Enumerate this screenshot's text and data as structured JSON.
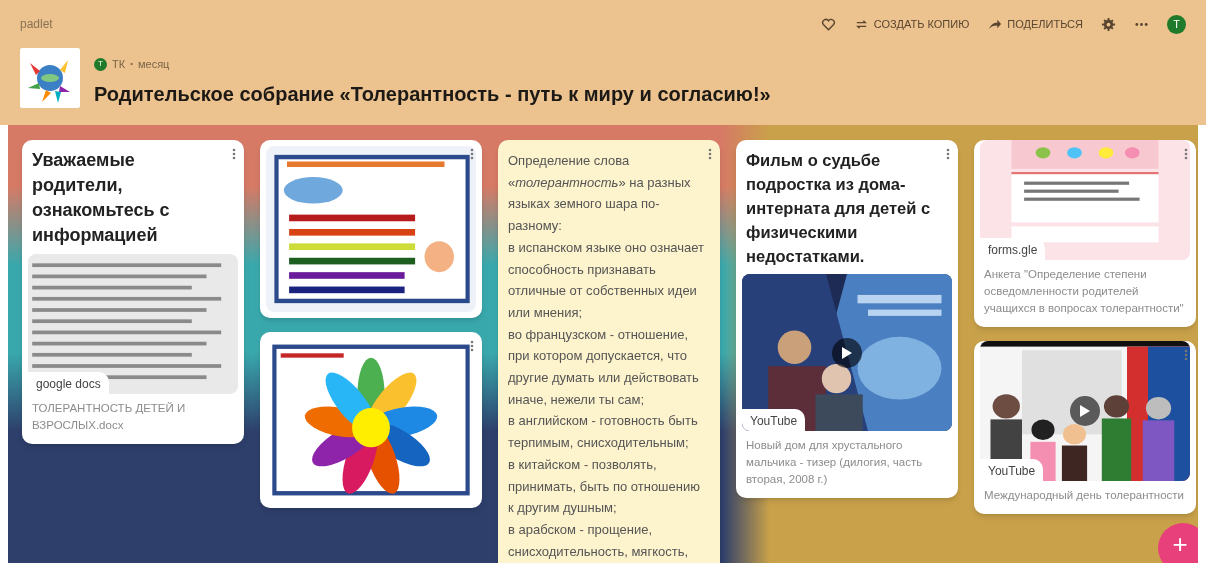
{
  "app": {
    "logo_text": "padlet"
  },
  "toolbar": {
    "actions": [
      {
        "kind": "like"
      },
      {
        "kind": "remix",
        "label": "СОЗДАТЬ КОПИЮ"
      },
      {
        "kind": "share",
        "label": "ПОДЕЛИТЬСЯ"
      },
      {
        "kind": "settings"
      },
      {
        "kind": "more"
      }
    ],
    "avatar": "T"
  },
  "board": {
    "author": {
      "avatar": "T",
      "name": "ТК",
      "separator": "•",
      "time": "месяц"
    },
    "title": "Родительское собрание «Толерантность - путь к миру и согласию!»"
  },
  "columns": [
    {
      "posts": [
        {
          "color": "#ffffff",
          "subject": "Уважаемые родители, ознакомьтесь с информацией",
          "attachment": {
            "kind": "document",
            "source": "google docs",
            "caption": "ТОЛЕРАНТНОСТЬ ДЕТЕЙ И ВЗРОСЛЫХ.docx"
          }
        }
      ]
    },
    {
      "posts": [
        {
          "color": "#ffffff"
        },
        {
          "color": "#ffffff"
        }
      ]
    },
    {
      "posts": [
        {
          "color": "#fdf3cd",
          "body": [
            "Определение слова «*толерантность*» на разных языках земного шара по-разному:",
            "в испанском языке оно означает способность признавать отличные от собственных идеи или мнения;",
            "во французском - отношение, при котором допускается, что другие думать или действовать иначе, нежели ты сам;",
            "в английском - готовность быть терпимым, снисходительным;",
            "в китайском - позволять, принимать, быть по отношению к другим душным;",
            "в арабском - прощение, снисходительность, мягкость,"
          ]
        }
      ]
    },
    {
      "posts": [
        {
          "color": "#ffffff",
          "subject": "Фильм о судьбе подростка из дома-интерната для детей с физическими недостатками.",
          "attachment": {
            "kind": "video",
            "source": "YouTube",
            "caption": "Новый дом для хрустального мальчика - тизер (дилогия, часть вторая, 2008 г.)"
          }
        }
      ]
    },
    {
      "posts": [
        {
          "color": "#ffffff",
          "attachment": {
            "kind": "form",
            "source": "forms.gle",
            "caption": "Анкета \"Определение степени осведомленности родителей учащихся в вопросах толерантности\""
          }
        },
        {
          "color": "#ffffff",
          "attachment": {
            "kind": "video",
            "source": "YouTube",
            "caption": "Международный день толерантности"
          }
        }
      ]
    }
  ],
  "add_button": {
    "label": "+"
  }
}
